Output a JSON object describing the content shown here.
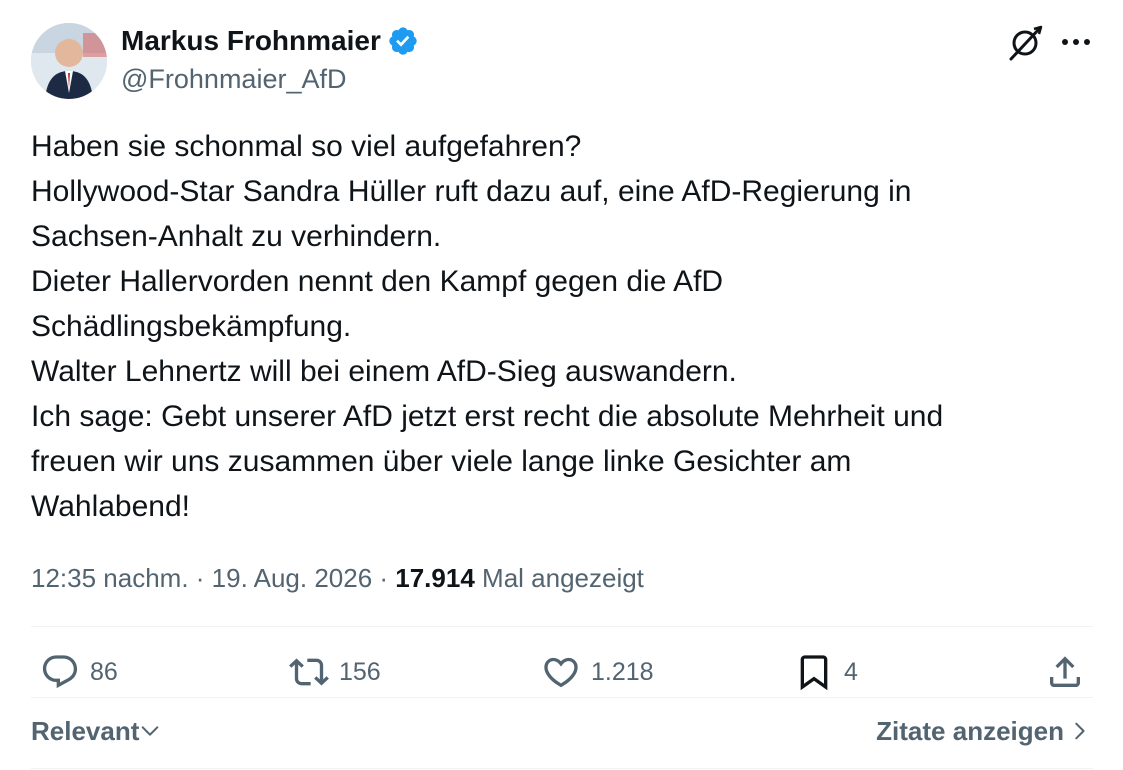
{
  "author": {
    "name": "Markus Frohnmaier",
    "handle": "@Frohnmaier_AfD",
    "verified": true,
    "verified_color": "#1d9bf0"
  },
  "icons": {
    "grok": "grok-icon",
    "more": "more-icon",
    "reply": "reply-icon",
    "retweet": "retweet-icon",
    "like": "like-icon",
    "bookmark": "bookmark-icon",
    "share": "share-icon"
  },
  "tweet": {
    "lines": [
      "Haben sie schonmal so viel aufgefahren?",
      "Hollywood-Star Sandra Hüller ruft dazu auf, eine AfD-Regierung in",
      "Sachsen-Anhalt zu verhindern.",
      "Dieter Hallervorden nennt den Kampf gegen die AfD",
      "Schädlingsbekämpfung.",
      "Walter Lehnertz will bei einem AfD-Sieg auswandern.",
      "Ich sage: Gebt unserer AfD jetzt erst recht die absolute Mehrheit und",
      "freuen wir uns zusammen über viele lange linke Gesichter am",
      "Wahlabend!"
    ]
  },
  "meta": {
    "time": "12:35 nachm.",
    "sep1": " · ",
    "date": "19. Aug. 2026",
    "sep2": " · ",
    "views": "17.914",
    "views_label": "Mal angezeigt"
  },
  "actions": {
    "replies": "86",
    "retweets": "156",
    "likes": "1.218",
    "bookmarks": "4"
  },
  "footer": {
    "sort_label": "Relevant",
    "quotes_label": "Zitate anzeigen"
  }
}
